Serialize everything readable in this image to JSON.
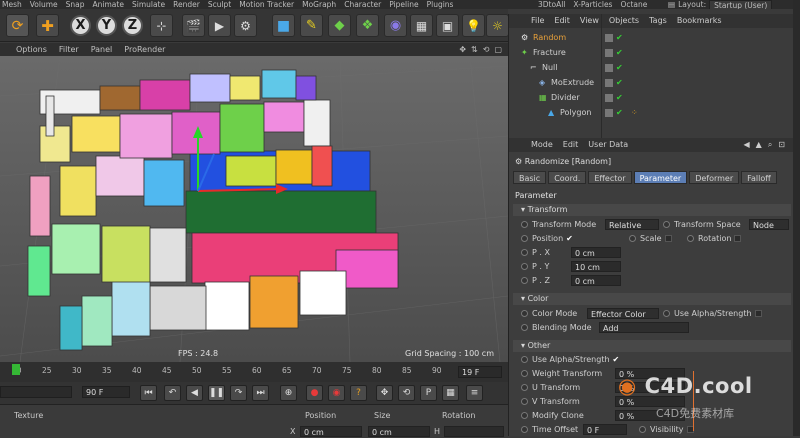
{
  "menubar": [
    "Mesh",
    "Volume",
    "Snap",
    "Animate",
    "Simulate",
    "Render",
    "Sculpt",
    "Motion Tracker",
    "MoGraph",
    "Character",
    "Pipeline",
    "Plugins"
  ],
  "rmenubar": [
    "3DtoAll",
    "X-Particles",
    "Octane"
  ],
  "layout": {
    "label": "Layout:",
    "value": "Startup (User)"
  },
  "toolbar": {
    "x": "X",
    "y": "Y",
    "z": "Z"
  },
  "viewport": {
    "menu": [
      "Options",
      "Filter",
      "Panel",
      "ProRender"
    ],
    "fps": "FPS : 24.8",
    "grid_spacing": "Grid Spacing : 100 cm"
  },
  "timeline": {
    "ticks": [
      "20",
      "25",
      "30",
      "35",
      "40",
      "45",
      "50",
      "55",
      "60",
      "65",
      "70",
      "75",
      "80",
      "85",
      "90"
    ],
    "frame_start": "20",
    "frame_end": "19 F",
    "current": "90 F"
  },
  "bottom": {
    "texture": "Texture",
    "position": "Position",
    "size": "Size",
    "rotation": "Rotation",
    "x_label": "X",
    "x_value": "0 cm",
    "x_size": "0 cm",
    "h_label": "H"
  },
  "objmgr": {
    "menu": [
      "File",
      "Edit",
      "View",
      "Objects",
      "Tags",
      "Bookmarks"
    ],
    "objects": [
      {
        "name": "Random",
        "indent": 0,
        "color": "#e8a03a"
      },
      {
        "name": "Fracture",
        "indent": 0,
        "color": "#d0d0d0"
      },
      {
        "name": "Null",
        "indent": 1,
        "color": "#d0d0d0"
      },
      {
        "name": "MoExtrude",
        "indent": 2,
        "color": "#d0d0d0"
      },
      {
        "name": "Divider",
        "indent": 2,
        "color": "#d0d0d0"
      },
      {
        "name": "Polygon",
        "indent": 3,
        "color": "#d0d0d0"
      }
    ]
  },
  "attr": {
    "menu": [
      "Mode",
      "Edit",
      "User Data"
    ],
    "object_title": "Randomize [Random]",
    "tabs": [
      "Basic",
      "Coord.",
      "Effector",
      "Parameter",
      "Deformer",
      "Falloff"
    ],
    "active_tab": "Parameter",
    "section_label": "Parameter",
    "transform": {
      "title": "Transform",
      "transform_mode_label": "Transform Mode",
      "transform_mode": "Relative",
      "transform_space_label": "Transform Space",
      "transform_space": "Node",
      "position_label": "Position",
      "scale_label": "Scale",
      "rotation_label": "Rotation",
      "px_label": "P . X",
      "px": "0 cm",
      "py_label": "P . Y",
      "py": "10 cm",
      "pz_label": "P . Z",
      "pz": "0 cm"
    },
    "color": {
      "title": "Color",
      "color_mode_label": "Color Mode",
      "color_mode": "Effector Color",
      "use_alpha_label": "Use Alpha/Strength",
      "blending_mode_label": "Blending Mode",
      "blending_mode": "Add"
    },
    "other": {
      "title": "Other",
      "use_alpha_label": "Use Alpha/Strength",
      "weight_label": "Weight Transform",
      "weight": "0 %",
      "u_label": "U Transform",
      "u": "0 %",
      "v_label": "V Transform",
      "v": "0 %",
      "modify_clone_label": "Modify Clone",
      "modify_clone": "0 %",
      "time_offset_label": "Time Offset",
      "time_offset": "0 F",
      "visibility_label": "Visibility"
    }
  },
  "watermark": {
    "brand": "C4D.cool",
    "sub": "C4D免费素材库"
  }
}
